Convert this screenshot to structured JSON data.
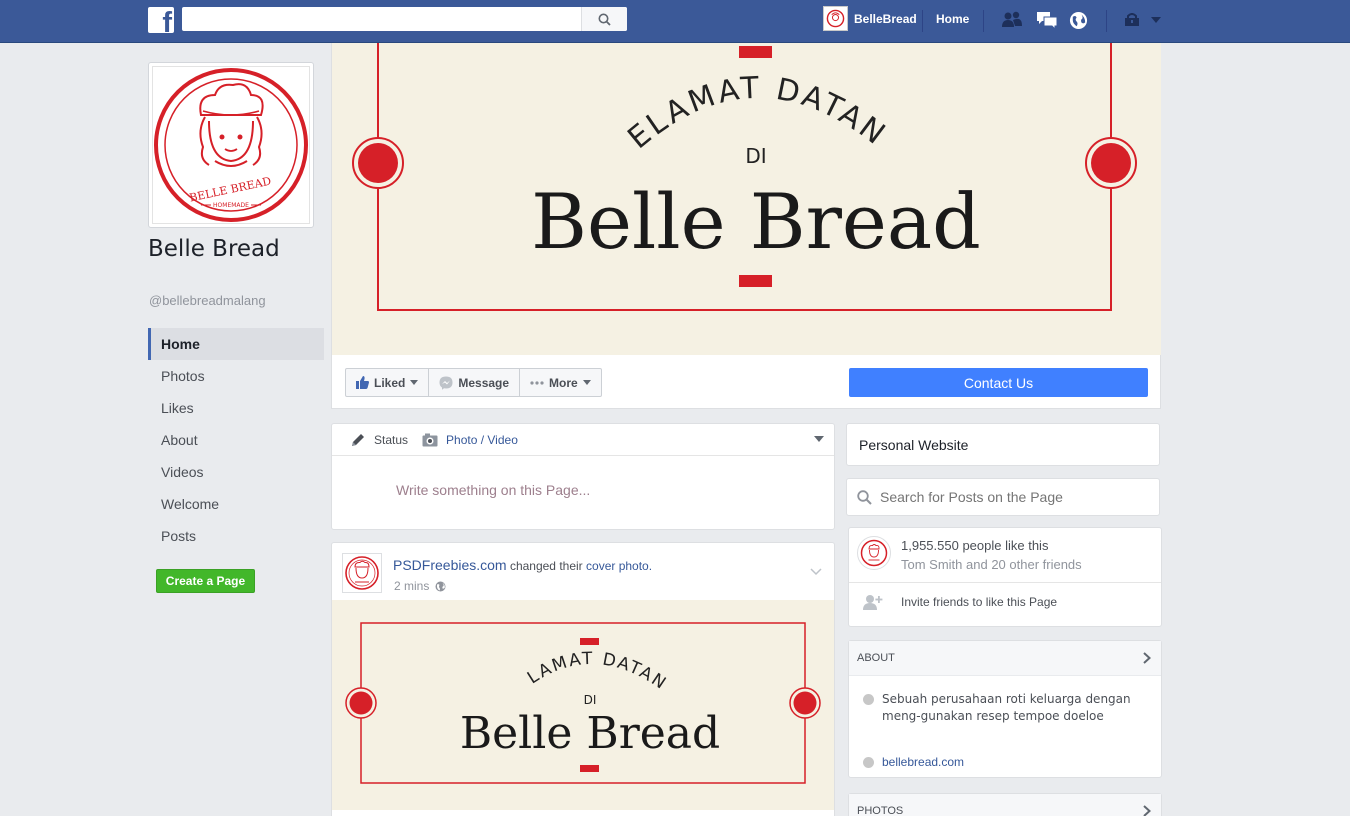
{
  "topbar": {
    "logo": "f",
    "search_placeholder": "",
    "profile_name": "BelleBread",
    "home_label": "Home",
    "icons": [
      "friend-requests-icon",
      "messages-icon",
      "notifications-globe-icon",
      "quick-help-icon",
      "account-caret-icon"
    ]
  },
  "page": {
    "name": "Belle Bread",
    "handle": "@bellebreadmalang",
    "logo_text": "BELLE BREAD",
    "logo_subtext": "HOMEMADE"
  },
  "left_nav": {
    "items": [
      "Home",
      "Photos",
      "Likes",
      "About",
      "Videos",
      "Welcome",
      "Posts"
    ],
    "active": "Home",
    "create_page": "Create a Page"
  },
  "cover": {
    "line1": "SELAMAT DATANG",
    "line2": "DI",
    "line3": "Belle Bread"
  },
  "actions": {
    "liked": "Liked",
    "message": "Message",
    "more": "More",
    "contact": "Contact Us"
  },
  "composer": {
    "status": "Status",
    "photo_video": "Photo / Video",
    "placeholder": "Write something on this Page..."
  },
  "post": {
    "author": "PSDFreebies.com",
    "action": "changed their",
    "link": "cover photo.",
    "time": "2 mins"
  },
  "sidebar": {
    "personal_website": "Personal Website",
    "search_placeholder": "Search for Posts on the Page",
    "likes_count": "1,955.550 people like this",
    "likes_friends": "Tom Smith and 20 other friends",
    "invite": "Invite friends to like this Page",
    "about_title": "ABOUT",
    "about_description": "Sebuah perusahaan roti keluarga dengan meng-gunakan resep tempoe doeloe",
    "website": "bellebread.com",
    "photos_title": "PHOTOS"
  },
  "colors": {
    "brand_blue": "#3b5998",
    "link": "#365899",
    "contact_button": "#4080ff",
    "create_page_green": "#42b72a",
    "accent_red": "#d62028"
  }
}
